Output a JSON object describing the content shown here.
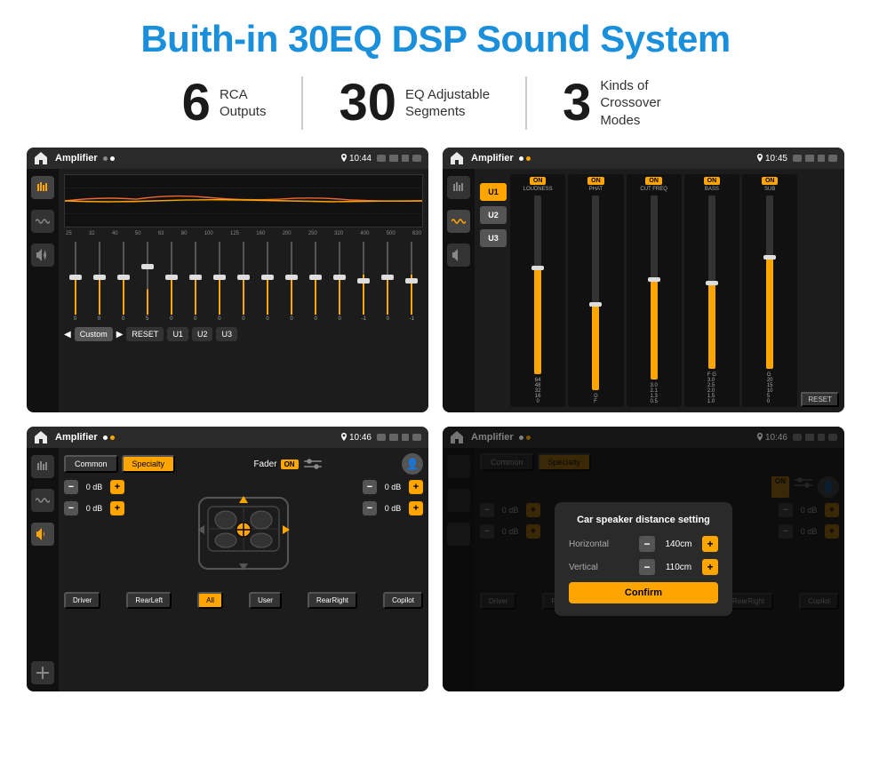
{
  "header": {
    "title": "Buith-in 30EQ DSP Sound System"
  },
  "stats": [
    {
      "number": "6",
      "label": "RCA\nOutputs"
    },
    {
      "number": "30",
      "label": "EQ Adjustable\nSegments"
    },
    {
      "number": "3",
      "label": "Kinds of\nCrossover Modes"
    }
  ],
  "screens": [
    {
      "id": "eq-screen",
      "app_name": "Amplifier",
      "time": "10:44",
      "type": "eq"
    },
    {
      "id": "crossover-screen",
      "app_name": "Amplifier",
      "time": "10:45",
      "type": "crossover"
    },
    {
      "id": "fader-screen",
      "app_name": "Amplifier",
      "time": "10:46",
      "type": "fader"
    },
    {
      "id": "dialog-screen",
      "app_name": "Amplifier",
      "time": "10:46",
      "type": "dialog"
    }
  ],
  "eq": {
    "freqs": [
      "25",
      "32",
      "40",
      "50",
      "63",
      "80",
      "100",
      "125",
      "160",
      "200",
      "250",
      "320",
      "400",
      "500",
      "630"
    ],
    "values": [
      "0",
      "0",
      "0",
      "5",
      "0",
      "0",
      "0",
      "0",
      "0",
      "0",
      "0",
      "0",
      "-1",
      "0",
      "-1"
    ],
    "presets": [
      "Custom",
      "RESET",
      "U1",
      "U2",
      "U3"
    ]
  },
  "crossover": {
    "u_buttons": [
      "U1",
      "U2",
      "U3"
    ],
    "panels": [
      {
        "label": "LOUDNESS",
        "on": true
      },
      {
        "label": "PHAT",
        "on": true
      },
      {
        "label": "CUT FREQ",
        "on": true
      },
      {
        "label": "BASS",
        "on": true
      },
      {
        "label": "SUB",
        "on": true
      }
    ]
  },
  "fader": {
    "tabs": [
      "Common",
      "Specialty"
    ],
    "fader_label": "Fader",
    "on_label": "ON",
    "db_values": [
      "0 dB",
      "0 dB",
      "0 dB",
      "0 dB"
    ],
    "buttons": [
      "Driver",
      "RearLeft",
      "All",
      "User",
      "RearRight",
      "Copilot"
    ]
  },
  "dialog": {
    "title": "Car speaker distance setting",
    "horizontal_label": "Horizontal",
    "horizontal_value": "140cm",
    "vertical_label": "Vertical",
    "vertical_value": "110cm",
    "confirm_label": "Confirm"
  }
}
